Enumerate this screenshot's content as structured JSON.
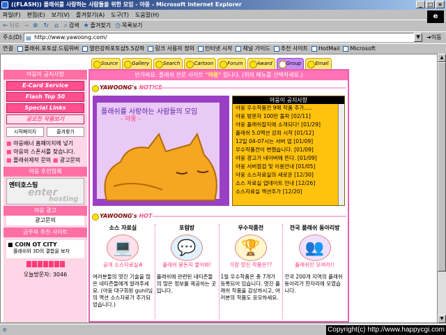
{
  "window": {
    "title": "((FLASH)) 플래쉬를 사랑하는 사람들을 위한 모임 - 야웅 - Microsoft Internet Explorer",
    "min": "_",
    "max": "□",
    "close": "×"
  },
  "menubar": [
    "파일(F)",
    "편집(E)",
    "보기(V)",
    "즐겨찾기(A)",
    "도구(T)",
    "도움말(H)"
  ],
  "toolbar": {
    "back": "뒤로",
    "forward": "→",
    "stop": "⊗",
    "refresh": "↻",
    "home": "⌂",
    "search": "검색",
    "favorites": "즐겨찾기",
    "history": "목록보기"
  },
  "address": {
    "label": "주소(D)",
    "url": "http://www.yawoong.com/",
    "go": "이동"
  },
  "links": {
    "label": "연결",
    "items": [
      "플래쉬.포토샵.드림위버",
      "열린강좌포토샵5.5강좌",
      "링크 사용자 정의",
      "인터넷 시작",
      "채널 가이드",
      "추천 사이트",
      "HotMail",
      "Microsoft"
    ]
  },
  "site": {
    "tabs": [
      "Source",
      "Gallery",
      "Search",
      "Cartoon",
      "Forum",
      "Award",
      "Group",
      "Email"
    ],
    "active_tab_index": 6,
    "welcome_pre": "반가와요.  플래쉬 전문 사이트 ",
    "welcome_name": "\"야웅\"",
    "welcome_post": " 입니다. (위의 메뉴를 선택하세요.)",
    "notice_title_a": "YAWOONG's",
    "notice_title_b": "NOTICE",
    "art_caption": "플래쉬를 사랑하는 사람들의 모임",
    "art_caption2": "- 야웅 -",
    "notice_header": "야웅이 공지사항",
    "notices": [
      "야웅 우수작품전 9매 작품 추가.....",
      "야웅 방문자 100만 돌파 [02/11]",
      "야웅 플래쉬잡지에 소개되다! [01/29]",
      "플래쉬 5.0액션 강좌 시작 [01/12]",
      "12일 04-07시는 서버 업 [01/09]",
      "우수작품전이 변했습니다. [01/09]",
      "야웅 광고가 네이버에 뜬다. [01/09]",
      "야웅 서버점검 및 이용안내 [01/05]",
      "야웅 소스자료실의 새로운 [12/30]",
      "소스 자료실 업데이트 안내 [12/26]",
      "소스자료실 액션추가 [12/20]"
    ],
    "hot_title_a": "YAWOONG's",
    "hot_title_b": "HOT",
    "hot": [
      {
        "head": "소스 자료실",
        "tag": "공개 소스자료실#",
        "desc": "여러분들의 멋진 기술을 많은 네티즌들에게 알려주세요. (야웅 대구회원 gunil님의 액션 소스자료가 추가되었습니다.)"
      },
      {
        "head": "포럼방",
        "tag": "플래쉬 묻돈지 물어봐!",
        "desc": "플래쉬에 관련된 네티즌들의 많은 정보를 제공하는 곳입니다."
      },
      {
        "head": "우수작품전",
        "tag": "가장 멋진 작품은??",
        "desc": "1월 우수작품은 총 7개가 등록되어 있습니다. 멋진 플래쉬 작품을 감상하시고, 여러분의 작품도 응모하세요."
      },
      {
        "head": "전국 플래쉬 동아리방",
        "tag": "플래쉬인 모여라!!",
        "desc": "전국 200개 지역의 플래쉬 동아리가 한자리에 모였습니다."
      }
    ],
    "left": {
      "notice_head": "야웅이 공지사항",
      "btns": [
        "E-Card Service",
        "Flash Top 50",
        "Special Links"
      ],
      "pbtn": "공모전 작품보기",
      "small": [
        "시작페이지",
        "즐겨찾기"
      ],
      "links": [
        "야웅배너 홈페이지에 넣기",
        "야웅의 스폰서를 찾습니다.",
        "플래쉬제작 문의",
        "광고문의"
      ],
      "partner_head": "야웅 추천업체",
      "host_a": "엔터호스팅",
      "host_b": "enter",
      "host_c": "hosting",
      "ad_head": "야웅 광고",
      "ad_link": "광고문의",
      "rec_head": "금주의 추천 사이트",
      "coin_a": "COIN OT CITY",
      "coin_b": "플래쉬와 3D의 결합을 보자",
      "visitor": "오늘방문자: 3046"
    }
  },
  "status": {
    "copyright": "Copyright(c) http://www.happycgi.com"
  }
}
